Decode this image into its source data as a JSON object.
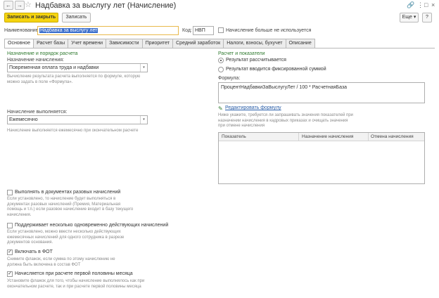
{
  "window": {
    "back_glyph": "←",
    "forward_glyph": "→",
    "favorite_glyph": "☆",
    "title": "Надбавка за выслугу лет (Начисление)",
    "link_glyph": "🔗",
    "menu_glyph": "⋮",
    "restore_glyph": "□",
    "close_glyph": "×"
  },
  "toolbar": {
    "save_close_label": "Записать и закрыть",
    "save_label": "Записать",
    "more_label": "Еще ▾",
    "help_label": "?"
  },
  "header": {
    "name_label": "Наименование:",
    "name_value": "Надбавка за выслугу лет",
    "code_label": "Код:",
    "code_value": "НВП",
    "unused_checkbox_label": "Начисление больше не используется",
    "unused_checked": false
  },
  "tabs": [
    {
      "label": "Основное",
      "active": true
    },
    {
      "label": "Расчет базы",
      "active": false
    },
    {
      "label": "Учет времени",
      "active": false
    },
    {
      "label": "Зависимости",
      "active": false
    },
    {
      "label": "Приоритет",
      "active": false
    },
    {
      "label": "Средний заработок",
      "active": false
    },
    {
      "label": "Налоги, взносы, бухучет",
      "active": false
    },
    {
      "label": "Описание",
      "active": false
    }
  ],
  "left": {
    "section_title": "Назначение и порядок расчета",
    "purpose_label": "Назначение начисления:",
    "purpose_value": "Повременная оплата труда и надбавки",
    "purpose_hint": "Вычисление результата расчета выполняется по формуле, которую можно задать в поле «Формула».",
    "performed_label": "Начисление выполняется:",
    "performed_value": "Ежемесячно",
    "performed_hint": "Начисление выполняется ежемесячно при окончательном расчете",
    "combo_arrow": "▾",
    "one_time_label": "Выполнять в документах разовых начислений",
    "one_time_checked": false,
    "one_time_hint": "Если установлено, то начисление будет выполняться в документах разовых начислений (Премия, Материальная помощь и т.п.) если разовое начисление входит в базу текущего начисления.",
    "multiple_label": "Поддерживает несколько одновременно действующих начислений",
    "multiple_checked": false,
    "multiple_hint": "Если установлено, можно ввести несколько действующих ежемесячных начислений для одного сотрудника в разрезе документов основания.",
    "fot_label": "Включать в ФОТ",
    "fot_checked": true,
    "fot_hint": "Снимите флажок, если сумма по этому начислению не должна быть включена в состав ФОТ",
    "half_month_label": "Начисляется при расчете первой половины месяца",
    "half_month_checked": true,
    "half_month_hint": "Установите флажок для того, чтобы начисление выполнялось как при окончательном расчете, так и при расчете первой половины месяца",
    "check_glyph": "✓"
  },
  "right": {
    "section_title": "Расчет и показатели",
    "radio_calculated": "Результат рассчитывается",
    "radio_fixed": "Результат вводится фиксированной суммой",
    "selected_radio": "calculated",
    "formula_label": "Формула:",
    "formula_value": "ПроцентНадбавкиЗаВыслугуЛет / 100 * РасчетнаяБаза",
    "edit_icon_glyph": "✎",
    "edit_formula_link": "Редактировать формулу",
    "indicators_hint": "Ниже укажите, требуется ли запрашивать значения показателей при назначении начисления в кадровых приказах и очищать значения при отмене начисления",
    "table_headers": [
      "Показатель",
      "Назначение начисления",
      "Отмена начисления"
    ],
    "table_rows": []
  },
  "colors": {
    "accent_green": "#2f7a2f",
    "primary_button": "#f5d40f",
    "link": "#2a5ea8",
    "selection": "#3b6ecc"
  }
}
